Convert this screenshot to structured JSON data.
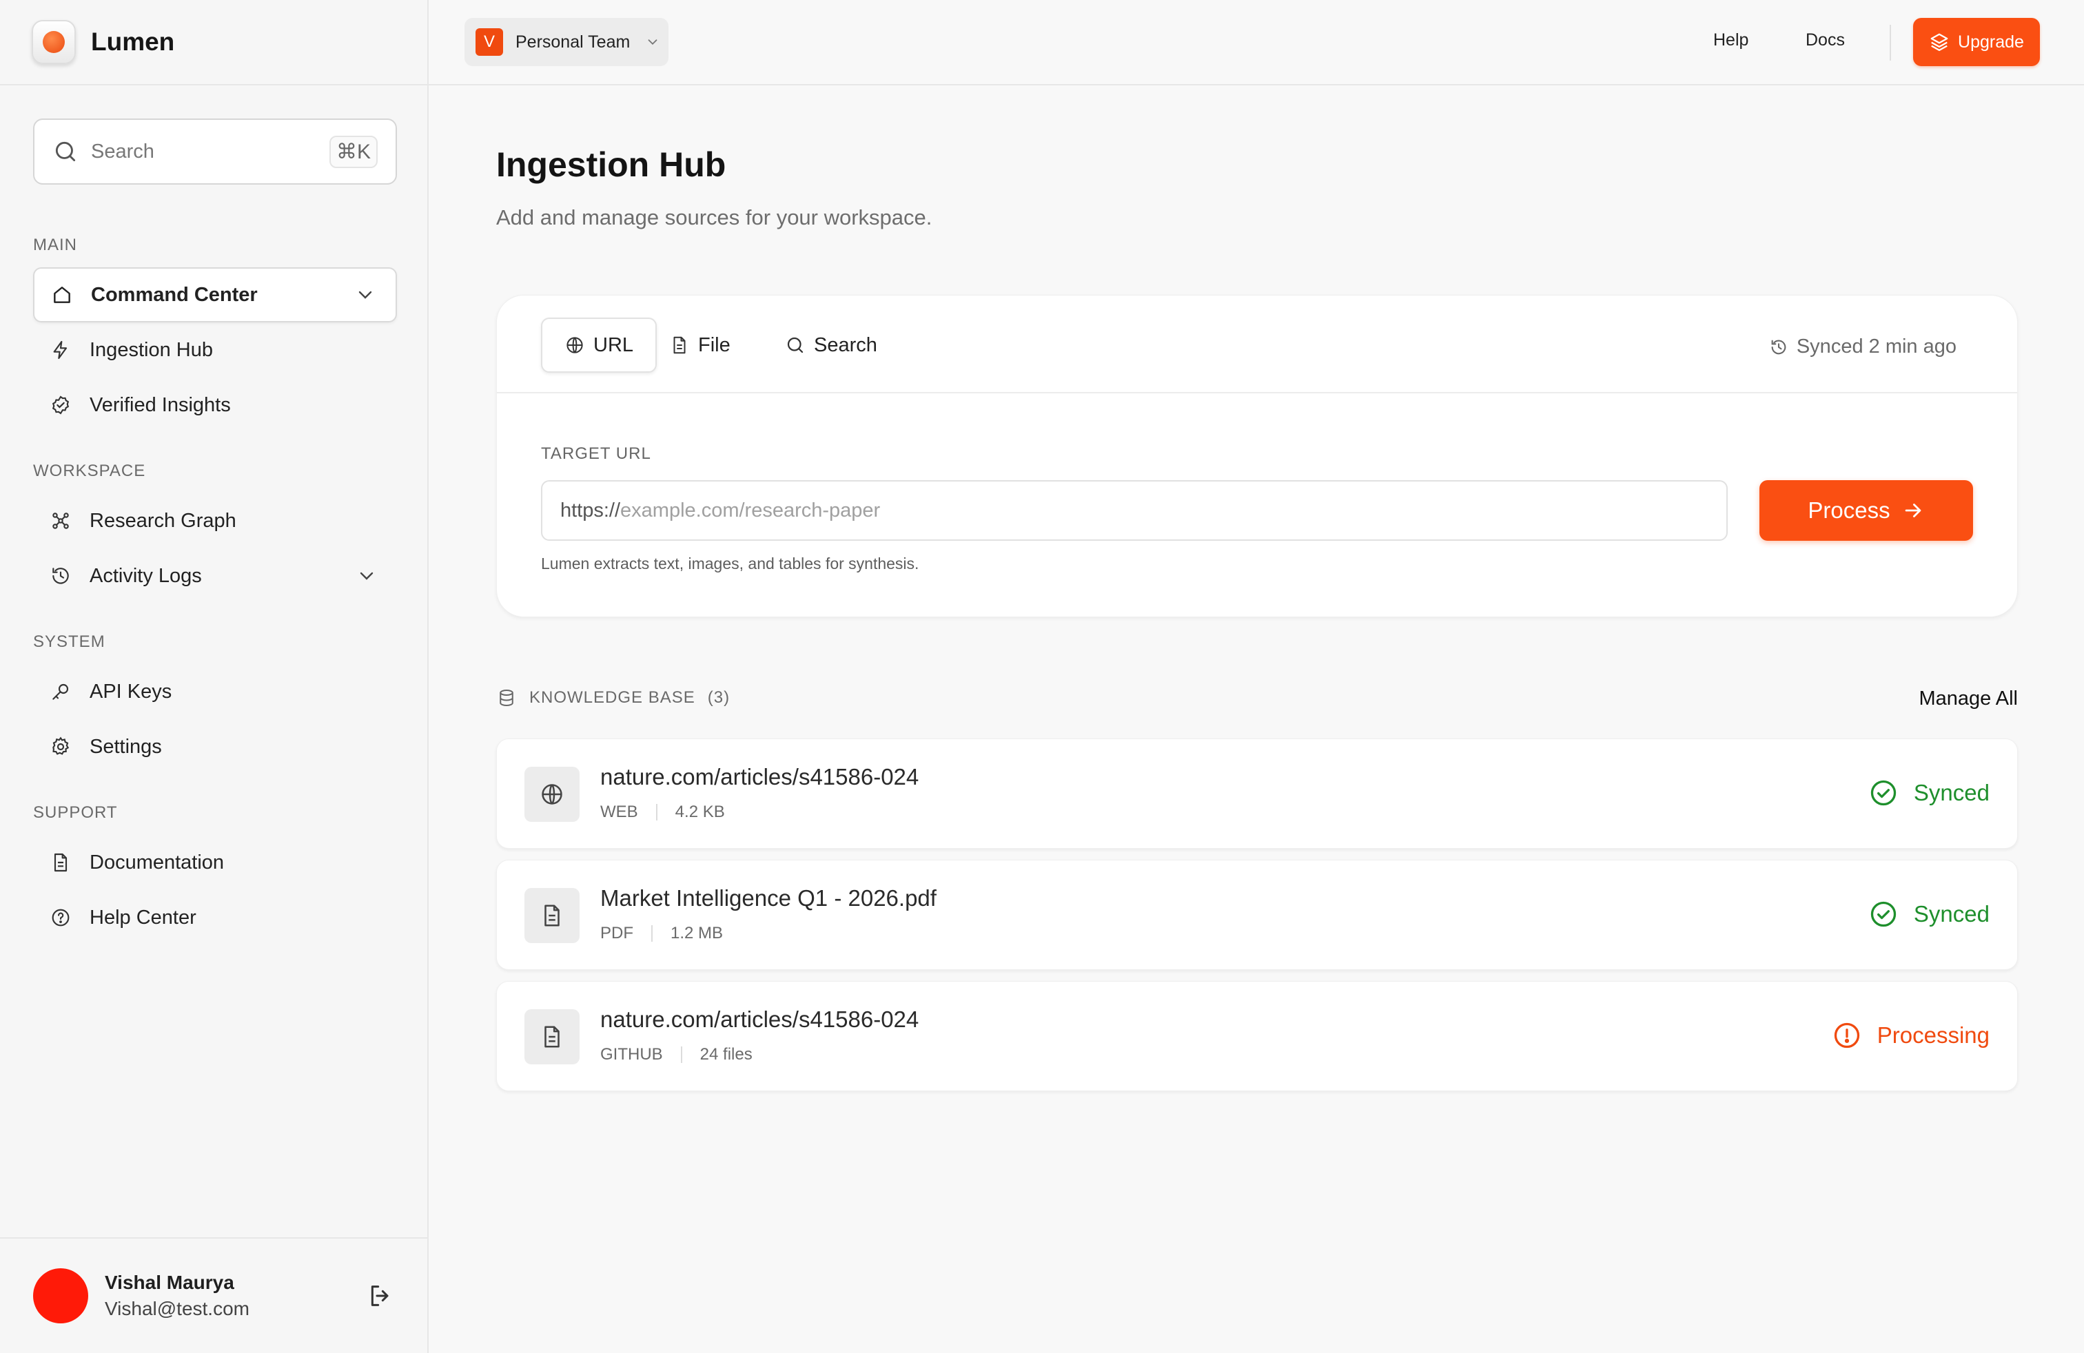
{
  "app": {
    "name": "Lumen"
  },
  "sidebar": {
    "search": {
      "placeholder": "Search",
      "shortcut": "⌘K"
    },
    "sections": [
      {
        "label": "MAIN",
        "items": [
          {
            "label": "Command Center",
            "icon": "home-icon",
            "active": true,
            "expandable": true
          },
          {
            "label": "Ingestion Hub",
            "icon": "bolt-icon"
          },
          {
            "label": "Verified Insights",
            "icon": "badge-check-icon"
          }
        ]
      },
      {
        "label": "WORKSPACE",
        "items": [
          {
            "label": "Research Graph",
            "icon": "graph-icon"
          },
          {
            "label": "Activity Logs",
            "icon": "history-icon",
            "expandable": true
          }
        ]
      },
      {
        "label": "SYSTEM",
        "items": [
          {
            "label": "API Keys",
            "icon": "key-icon"
          },
          {
            "label": "Settings",
            "icon": "gear-icon"
          }
        ]
      },
      {
        "label": "SUPPORT",
        "items": [
          {
            "label": "Documentation",
            "icon": "document-icon"
          },
          {
            "label": "Help Center",
            "icon": "help-circle-icon"
          }
        ]
      }
    ],
    "user": {
      "name": "Vishal Maurya",
      "email": "Vishal@test.com"
    }
  },
  "topbar": {
    "team": {
      "initial": "V",
      "name": "Personal Team"
    },
    "links": [
      "Help",
      "Docs"
    ],
    "upgrade_label": "Upgrade"
  },
  "main": {
    "title": "Ingestion Hub",
    "subtitle": "Add and manage sources for your workspace.",
    "tabs": [
      {
        "label": "URL",
        "icon": "globe-icon",
        "active": true
      },
      {
        "label": "File",
        "icon": "file-icon"
      },
      {
        "label": "Search",
        "icon": "search-icon"
      }
    ],
    "synced_label": "Synced 2 min ago",
    "target_label": "TARGET URL",
    "url_prefix": "https://",
    "url_placeholder": "example.com/research-paper",
    "process_label": "Process",
    "help_text": "Lumen extracts text, images, and tables for synthesis.",
    "knowledge_base": {
      "title": "KNOWLEDGE BASE",
      "count": "(3)",
      "manage_label": "Manage All",
      "items": [
        {
          "title": "nature.com/articles/s41586-024",
          "type": "WEB",
          "size": "4.2 KB",
          "status": "Synced",
          "icon": "globe-icon"
        },
        {
          "title": "Market Intelligence Q1 - 2026.pdf",
          "type": "PDF",
          "size": "1.2 MB",
          "status": "Synced",
          "icon": "file-icon"
        },
        {
          "title": "nature.com/articles/s41586-024",
          "type": "GITHUB",
          "size": "24 files",
          "status": "Processing",
          "icon": "file-icon"
        }
      ]
    }
  },
  "colors": {
    "accent": "#fa4f12",
    "success": "#1e8f2c",
    "avatar": "#ff1a08"
  }
}
